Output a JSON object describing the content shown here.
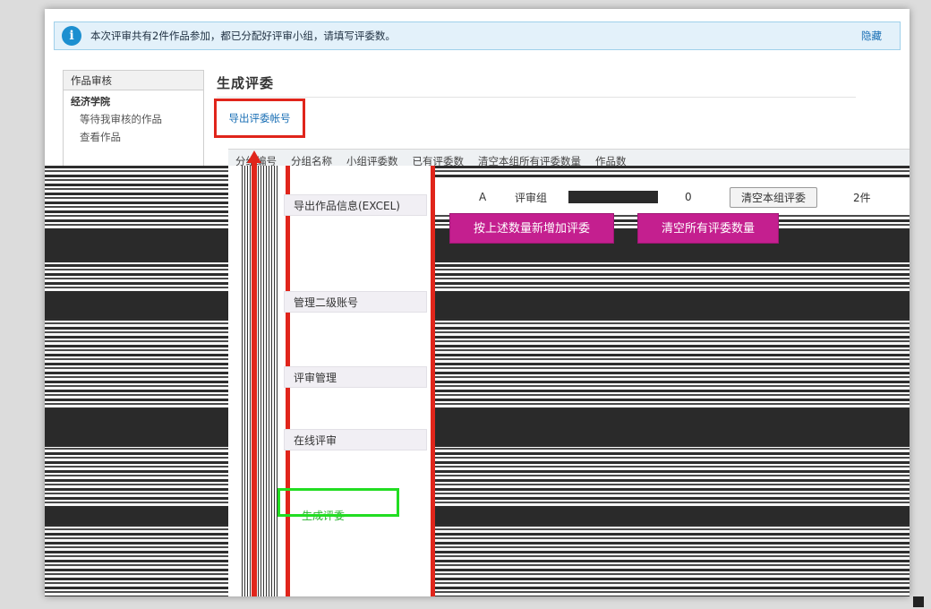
{
  "notice": {
    "text": "本次评审共有2件作品参加，都已分配好评审小组，请填写评委数。",
    "hide": "隐藏"
  },
  "left_panel": {
    "header": "作品审核",
    "college": "经济学院",
    "links": [
      "等待我审核的作品",
      "查看作品"
    ]
  },
  "page_title": "生成评委",
  "export_link": "导出评委帐号",
  "table": {
    "headers": [
      "分组编号",
      "分组名称",
      "小组评委数",
      "已有评委数",
      "清空本组所有评委数量",
      "作品数"
    ],
    "row": {
      "group_id": "A",
      "group_name": "评审组",
      "existing": "0",
      "clear_button": "清空本组评委",
      "works": "2件"
    }
  },
  "menu": {
    "sections": [
      "导出作品信息(EXCEL)",
      "管理二级账号",
      "评审管理",
      "在线评审"
    ],
    "items": [
      "生成评委"
    ]
  },
  "buttons": {
    "add": "按上述数量新增加评委",
    "clear_all": "清空所有评委数量"
  },
  "colors": {
    "accent_magenta": "#c41f8f",
    "highlight_red": "#e0251b",
    "highlight_green": "#22dd22",
    "link_blue": "#1a6fb5"
  }
}
